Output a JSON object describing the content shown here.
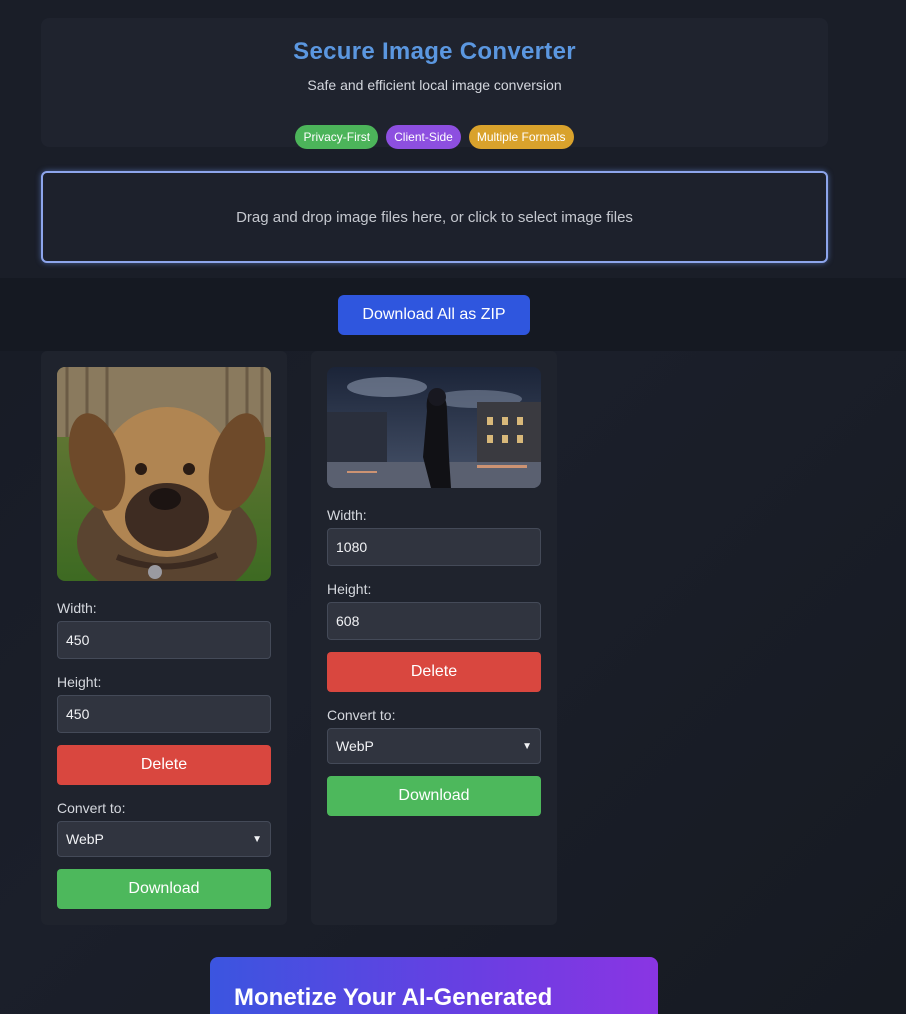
{
  "header": {
    "title": "Secure Image Converter",
    "subtitle": "Safe and efficient local image conversion",
    "badges": [
      "Privacy-First",
      "Client-Side",
      "Multiple Formats"
    ]
  },
  "dropzone": {
    "text": "Drag and drop image files here, or click to select image files"
  },
  "zip_button": "Download All as ZIP",
  "images": [
    {
      "thumbnail": "dog-photo",
      "width_label": "Width:",
      "width_value": "450",
      "height_label": "Height:",
      "height_value": "450",
      "delete_label": "Delete",
      "convert_label": "Convert to:",
      "format": "WebP",
      "download_label": "Download"
    },
    {
      "thumbnail": "anime-night-street",
      "width_label": "Width:",
      "width_value": "1080",
      "height_label": "Height:",
      "height_value": "608",
      "delete_label": "Delete",
      "convert_label": "Convert to:",
      "format": "WebP",
      "download_label": "Download"
    }
  ],
  "promo": {
    "title": "Monetize Your AI-Generated"
  },
  "colors": {
    "title": "#5b97e0",
    "badge_green": "#4cb45a",
    "badge_purple": "#8d4fe0",
    "badge_amber": "#d9a22c",
    "primary": "#2f56de",
    "danger": "#d9473f",
    "success": "#4db85c"
  }
}
